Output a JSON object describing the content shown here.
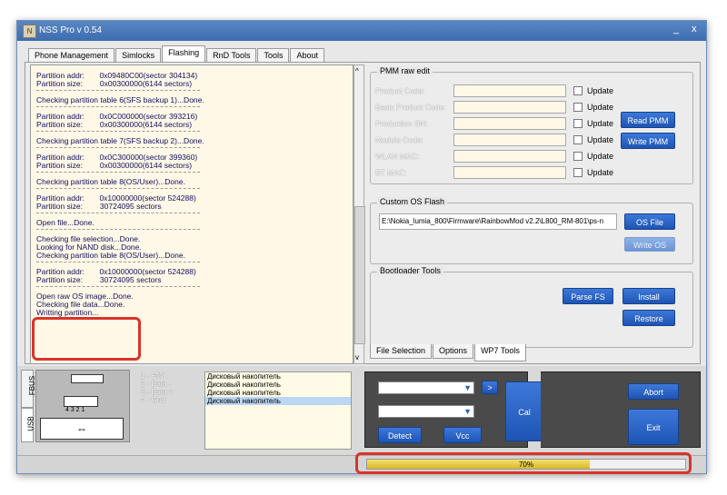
{
  "window": {
    "title": "NSS Pro v 0.54",
    "minimize": "_",
    "close": "x",
    "app_icon": "app-icon"
  },
  "tabs": [
    "Phone Management",
    "Simlocks",
    "Flashing",
    "RnD Tools",
    "Tools",
    "About"
  ],
  "active_tab": "Flashing",
  "log": {
    "lines": [
      "Partition addr:       0x09480C00(sector 304134)",
      "Partition size:        0x00300000(6144 sectors)",
      "Checking partition table 6(SFS backup 1)...Done.",
      "Partition addr:       0x0C000000(sector 393216)",
      "Partition size:        0x00300000(6144 sectors)",
      "Checking partition table 7(SFS backup 2)...Done.",
      "Partition addr:       0x0C300000(sector 399360)",
      "Partition size:        0x00300000(6144 sectors)",
      "Checking partition table 8(OS/User)...Done.",
      "Partition addr:       0x10000000(sector 524288)",
      "Partition size:        30724095 sectors",
      "Open file...Done.",
      "Checking file selection...Done.",
      "Looking for NAND disk...Done.",
      "Checking partition table 8(OS/User)...Done.",
      "Partition addr:       0x10000000(sector 524288)",
      "Partition size:        30724095 sectors",
      "Open raw OS image...Done.",
      "Checking file data...Done.",
      "Writting partition..."
    ]
  },
  "pmm": {
    "title": "PMM raw edit",
    "fields": [
      "Product Code:",
      "Basic Product Code:",
      "Production SN:",
      "Module Code:",
      "WLAN MAC:",
      "BT MAC:"
    ],
    "update_label": "Update",
    "read_button": "Read PMM",
    "write_button": "Write PMM"
  },
  "custom_os": {
    "title": "Custom OS Flash",
    "path": "E:\\Nokia_lumia_800\\Firmware\\RainbowMod v2.2\\L800_RM-801\\ps-n",
    "os_file_button": "OS File",
    "write_os_button": "Write OS"
  },
  "bootloader": {
    "title": "Bootloader Tools",
    "parse_button": "Parse FS",
    "install_button": "Install",
    "restore_button": "Restore"
  },
  "right_tabs": [
    "File Selection",
    "Options",
    "WP7 Tools"
  ],
  "right_active_tab": "WP7 Tools",
  "usb": {
    "side_tabs": [
      "FBUS",
      "USB"
    ],
    "pins_label": "4 3 2 1",
    "pinout": [
      "1 - +5V",
      "2 - Data -",
      "3 - Data +",
      "4 - Gnd"
    ],
    "devices": [
      "Дисковый накопитель",
      "Дисковый накопитель",
      "Дисковый накопитель",
      "Дисковый накопитель"
    ],
    "selected_device_index": 3
  },
  "controls": {
    "go_button": ">",
    "cal_button": "Cal",
    "detect_button": "Detect",
    "vcc_button": "Vcc",
    "abort_button": "Abort",
    "exit_button": "Exit"
  },
  "progress": {
    "text": "70%",
    "value": 0.7
  }
}
